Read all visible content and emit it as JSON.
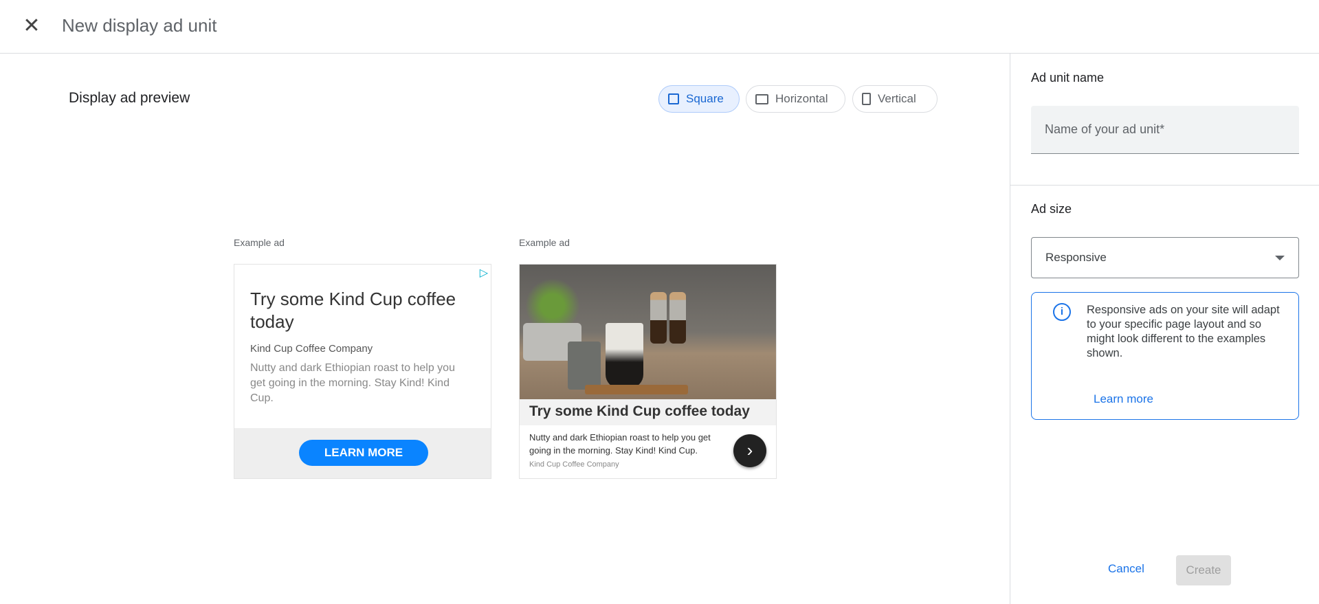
{
  "header": {
    "title": "New display ad unit",
    "close_icon": "close-icon"
  },
  "preview": {
    "title": "Display ad preview",
    "toggles": [
      {
        "label": "Square",
        "selected": true
      },
      {
        "label": "Horizontal",
        "selected": false
      },
      {
        "label": "Vertical",
        "selected": false
      }
    ]
  },
  "ads": [
    {
      "label": "Example ad",
      "headline": "Try some Kind Cup coffee today",
      "company": "Kind Cup Coffee Company",
      "description": "Nutty and dark Ethiopian roast to help you get going in the morning. Stay Kind! Kind Cup.",
      "cta": "LEARN MORE",
      "cta_color": "#0a84ff"
    },
    {
      "label": "Example ad",
      "headline": "Try some Kind Cup coffee today",
      "company": "Kind Cup Coffee Company",
      "description": "Nutty and dark Ethiopian roast to help you get going in the morning. Stay Kind! Kind Cup."
    }
  ],
  "panel": {
    "name_label": "Ad unit name",
    "name_placeholder": "Name of your ad unit*",
    "name_value": "",
    "size_label": "Ad size",
    "size_value": "Responsive",
    "info_text": "Responsive ads on your site will adapt to your specific page layout and so might look different to the examples shown.",
    "learn_more": "Learn more",
    "cancel": "Cancel",
    "create": "Create"
  },
  "colors": {
    "accent": "#1a73e8",
    "selected_bg": "#e8f0fe"
  }
}
